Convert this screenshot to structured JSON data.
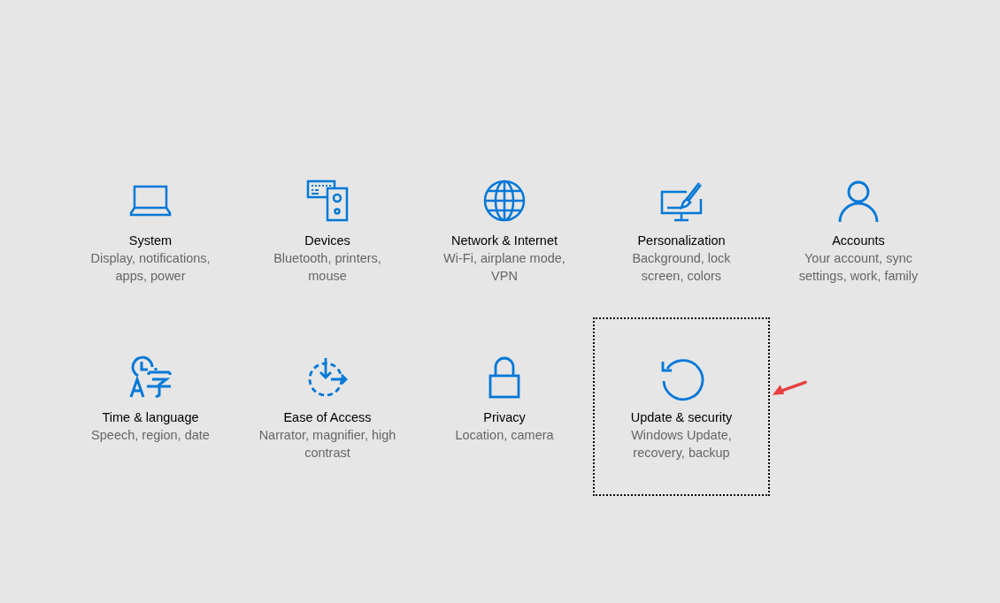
{
  "categories": [
    {
      "title": "System",
      "description": "Display, notifications, apps, power",
      "selected": false
    },
    {
      "title": "Devices",
      "description": "Bluetooth, printers, mouse",
      "selected": false
    },
    {
      "title": "Network & Internet",
      "description": "Wi-Fi, airplane mode, VPN",
      "selected": false
    },
    {
      "title": "Personalization",
      "description": "Background, lock screen, colors",
      "selected": false
    },
    {
      "title": "Accounts",
      "description": "Your account, sync settings, work, family",
      "selected": false
    },
    {
      "title": "Time & language",
      "description": "Speech, region, date",
      "selected": false
    },
    {
      "title": "Ease of Access",
      "description": "Narrator, magnifier, high contrast",
      "selected": false
    },
    {
      "title": "Privacy",
      "description": "Location, camera",
      "selected": false
    },
    {
      "title": "Update & security",
      "description": "Windows Update, recovery, backup",
      "selected": true
    }
  ]
}
